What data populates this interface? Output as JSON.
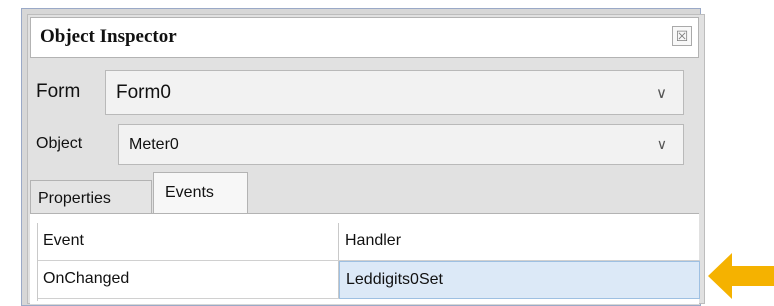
{
  "window": {
    "title": "Object Inspector",
    "close_glyph": "☒"
  },
  "form_selector": {
    "label": "Form",
    "value": "Form0"
  },
  "object_selector": {
    "label": "Object",
    "value": "Meter0"
  },
  "tabs": [
    {
      "label": "Properties",
      "selected": false
    },
    {
      "label": "Events",
      "selected": true
    }
  ],
  "events_table": {
    "columns": [
      "Event",
      "Handler"
    ],
    "rows": [
      {
        "event": "OnChanged",
        "handler": "Leddigits0Set"
      }
    ]
  },
  "icons": {
    "dropdown": "chevron-down-icon",
    "close": "close-icon",
    "pointer": "arrow-left-icon"
  },
  "colors": {
    "arrow": "#f5b200",
    "selection": "#dce9f7",
    "frame_border": "#9aa9c7"
  }
}
